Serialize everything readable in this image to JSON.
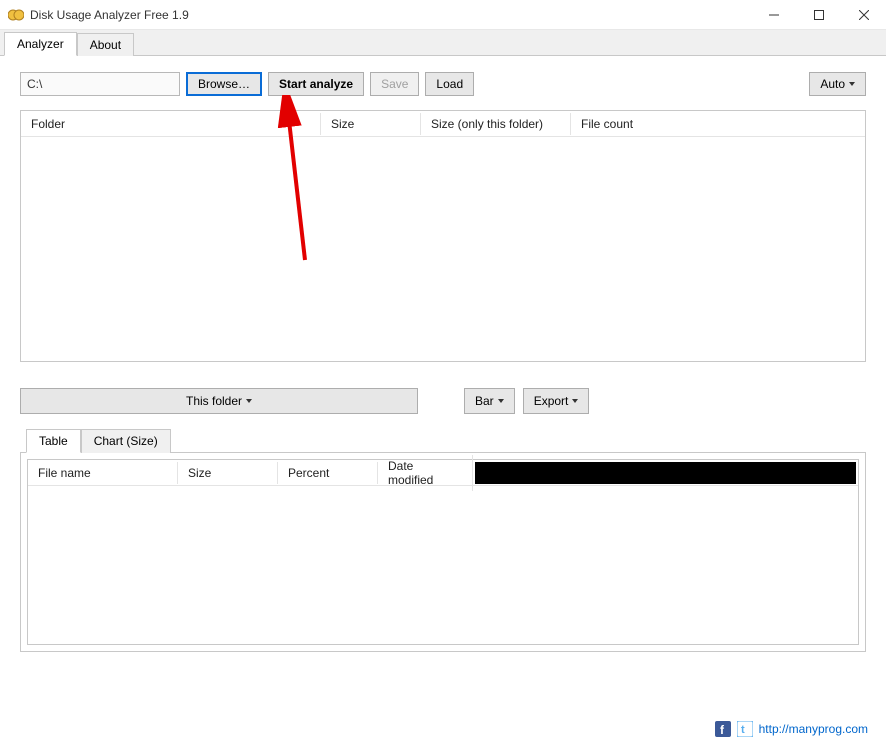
{
  "window": {
    "title": "Disk Usage Analyzer Free 1.9"
  },
  "main_tabs": {
    "analyzer": "Analyzer",
    "about": "About"
  },
  "toolbar": {
    "path_value": "C:\\",
    "browse": "Browse…",
    "start_analyze": "Start analyze",
    "save": "Save",
    "load": "Load",
    "auto": "Auto"
  },
  "top_grid": {
    "headers": {
      "folder": "Folder",
      "size": "Size",
      "size_only": "Size (only this folder)",
      "file_count": "File count"
    }
  },
  "mid": {
    "this_folder": "This folder",
    "bar": "Bar",
    "export": "Export"
  },
  "inner_tabs": {
    "table": "Table",
    "chart_size": "Chart (Size)"
  },
  "bottom_grid": {
    "headers": {
      "file_name": "File name",
      "size": "Size",
      "percent": "Percent",
      "date_modified": "Date modified"
    }
  },
  "footer": {
    "url": "http://manyprog.com"
  }
}
